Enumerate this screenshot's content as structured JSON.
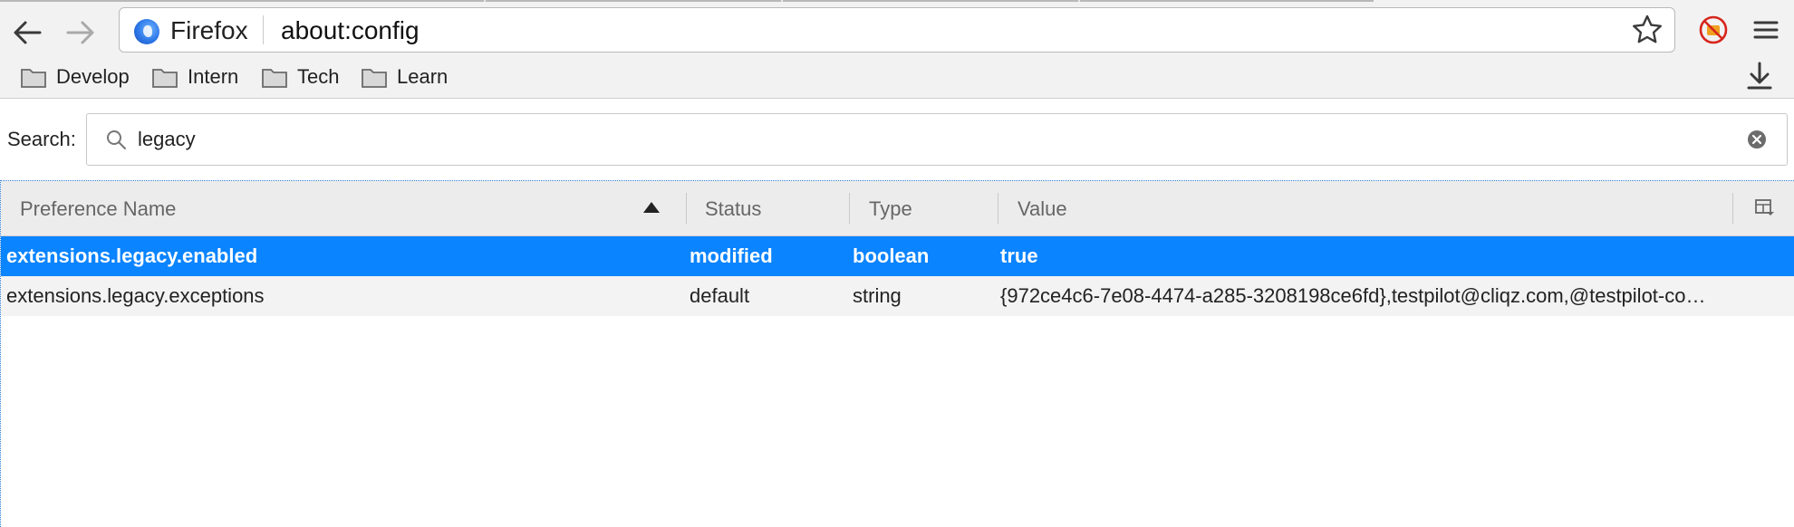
{
  "browser": {
    "identity_label": "Firefox",
    "url": "about:config",
    "accent": "#0a84ff"
  },
  "toolbar": {
    "back_icon": "back-arrow-icon",
    "forward_icon": "forward-arrow-icon",
    "bookmark_star_icon": "star-icon",
    "extension_icon": "blocked-extension-icon",
    "menu_icon": "hamburger-menu-icon",
    "download_icon": "download-icon"
  },
  "bookmarks": [
    {
      "label": "Develop",
      "icon": "folder-icon"
    },
    {
      "label": "Intern",
      "icon": "folder-icon"
    },
    {
      "label": "Tech",
      "icon": "folder-icon"
    },
    {
      "label": "Learn",
      "icon": "folder-icon"
    }
  ],
  "search": {
    "label": "Search:",
    "value": "legacy"
  },
  "table": {
    "columns": [
      "Preference Name",
      "Status",
      "Type",
      "Value"
    ],
    "sorted_column": "Preference Name",
    "sort_direction": "ascending",
    "rows": [
      {
        "name": "extensions.legacy.enabled",
        "status": "modified",
        "type": "boolean",
        "value": "true",
        "selected": true
      },
      {
        "name": "extensions.legacy.exceptions",
        "status": "default",
        "type": "string",
        "value": "{972ce4c6-7e08-4474-a285-3208198ce6fd},testpilot@cliqz.com,@testpilot-co…",
        "selected": false
      }
    ]
  }
}
